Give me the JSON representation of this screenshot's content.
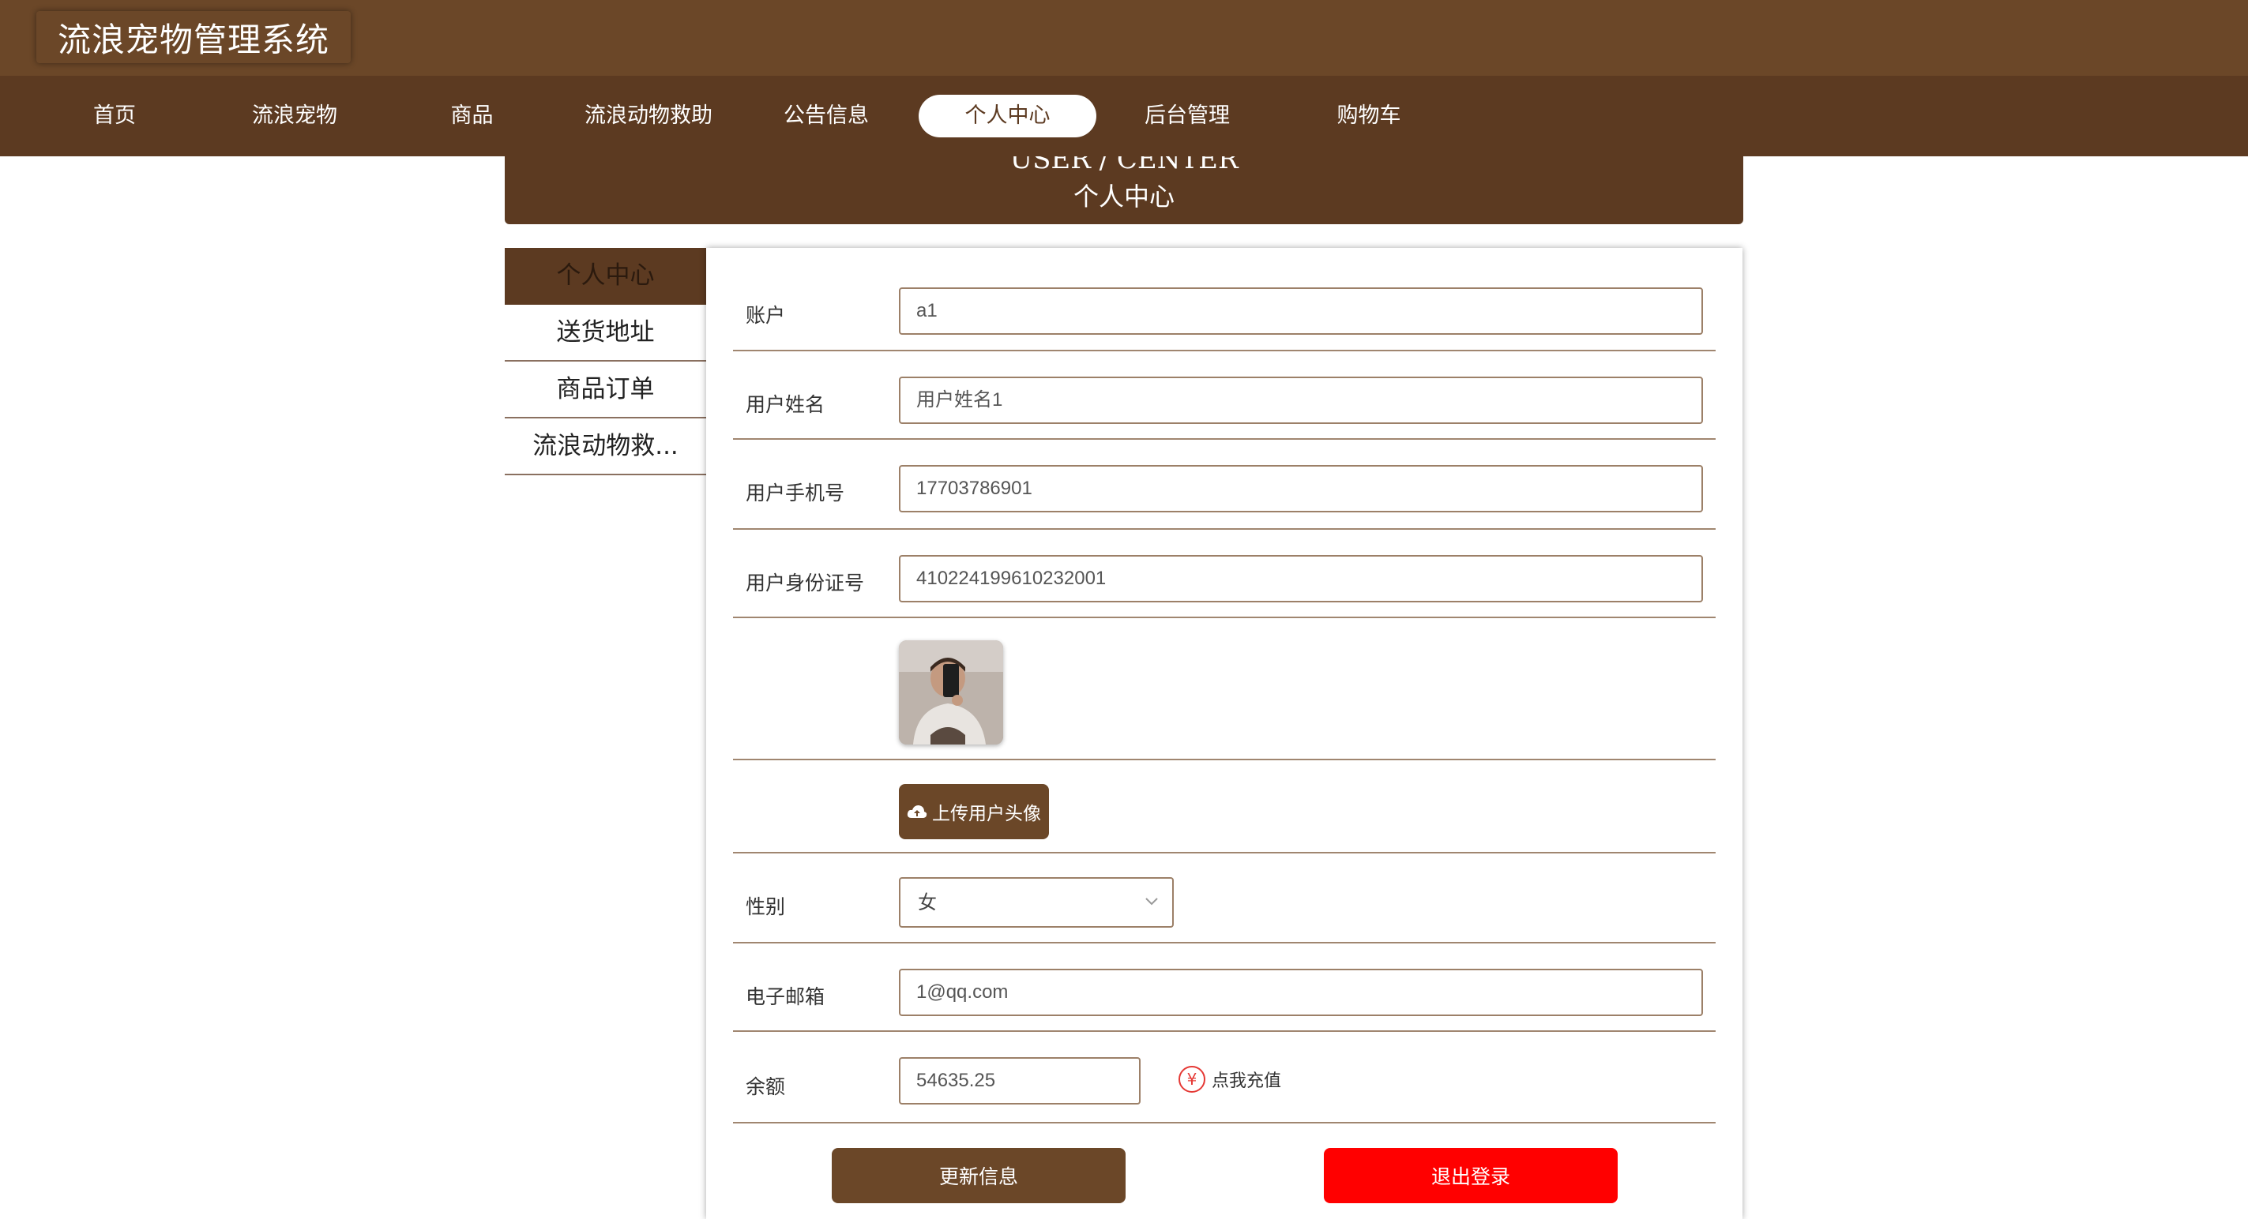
{
  "header": {
    "title": "流浪宠物管理系统"
  },
  "nav": {
    "items": [
      {
        "label": "首页"
      },
      {
        "label": "流浪宠物"
      },
      {
        "label": "商品"
      },
      {
        "label": "流浪动物救助"
      },
      {
        "label": "公告信息"
      },
      {
        "label": "个人中心",
        "active": true
      },
      {
        "label": "后台管理"
      },
      {
        "label": "购物车"
      }
    ]
  },
  "banner": {
    "title_en": "USER / CENTER",
    "title_cn": "个人中心"
  },
  "sidebar": {
    "items": [
      {
        "label": "个人中心",
        "active": true
      },
      {
        "label": "送货地址"
      },
      {
        "label": "商品订单"
      },
      {
        "label": "流浪动物救..."
      }
    ]
  },
  "form": {
    "account": {
      "label": "账户",
      "value": "a1"
    },
    "username": {
      "label": "用户姓名",
      "value": "用户姓名1"
    },
    "phone": {
      "label": "用户手机号",
      "value": "17703786901"
    },
    "id_card": {
      "label": "用户身份证号",
      "value": "410224199610232001"
    },
    "upload_label": "上传用户头像",
    "gender": {
      "label": "性别",
      "value": "女"
    },
    "email": {
      "label": "电子邮箱",
      "value": "1@qq.com"
    },
    "balance": {
      "label": "余额",
      "value": "54635.25",
      "recharge_label": "点我充值",
      "recharge_icon": "¥"
    }
  },
  "buttons": {
    "update": "更新信息",
    "logout": "退出登录"
  },
  "colors": {
    "brand": "#6b4728",
    "nav": "#5c3a21",
    "danger": "#ff0000"
  }
}
